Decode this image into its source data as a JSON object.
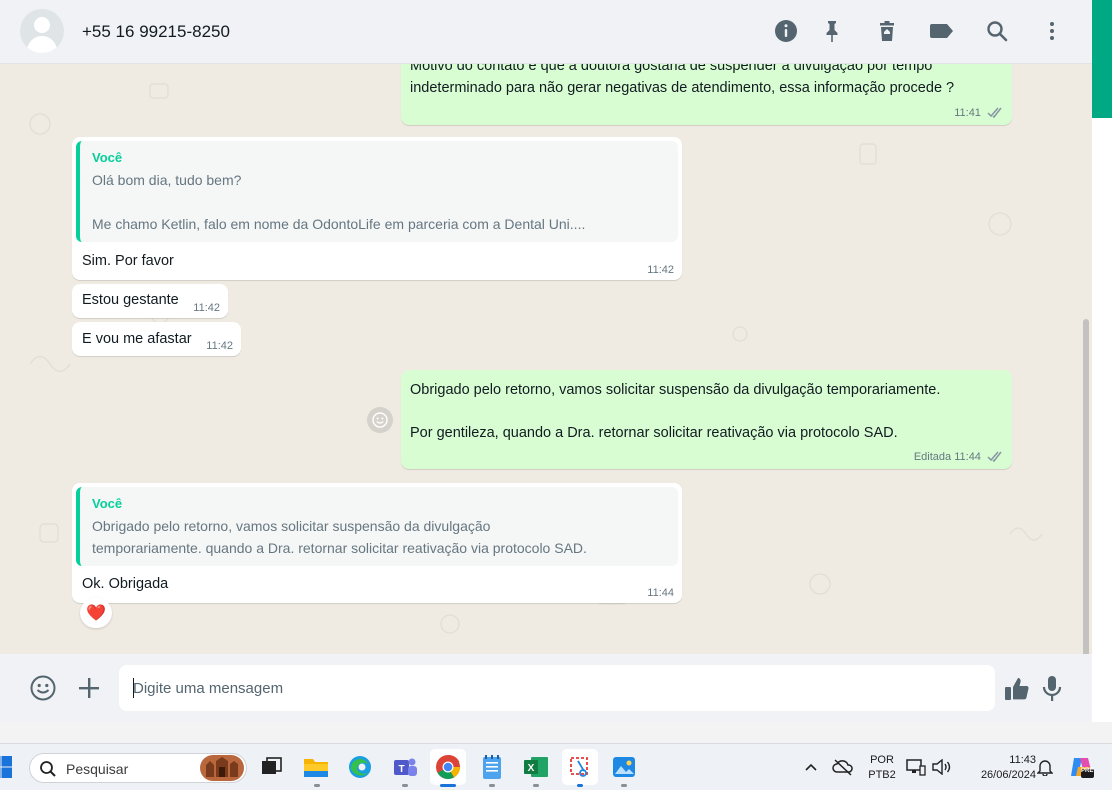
{
  "header": {
    "contact_name": "+55 16 99215-8250",
    "icons": [
      "info-icon",
      "pin-icon",
      "trash-icon",
      "label-icon",
      "search-icon",
      "more-vertical-icon"
    ]
  },
  "messages": {
    "m1": {
      "text_line1": "Motivo do contato é que a doutora gostaria de suspender a divulgação por tempo",
      "text_line2": "indeterminado para não gerar negativas de atendimento, essa informação procede ?",
      "time": "11:41"
    },
    "m2": {
      "quote_author": "Você",
      "quote_line1": "Olá bom dia, tudo bem?",
      "quote_line2": "Me chamo Ketlin, falo em nome da OdontoLife em parceria com a Dental Uni....",
      "text": "Sim. Por favor",
      "time": "11:42"
    },
    "m3": {
      "text": "Estou gestante",
      "time": "11:42"
    },
    "m4": {
      "text": "E vou me afastar",
      "time": "11:42"
    },
    "m5": {
      "text_line1": "Obrigado pelo retorno, vamos solicitar suspensão da divulgação temporariamente.",
      "text_line2": "Por gentileza, quando a Dra. retornar solicitar reativação via protocolo SAD.",
      "edited_label": "Editada",
      "time": "11:44"
    },
    "m6": {
      "quote_author": "Você",
      "quote_line1": "Obrigado pelo retorno, vamos solicitar suspensão da divulgação",
      "quote_line2": "temporariamente. quando a Dra. retornar solicitar reativação via protocolo SAD.",
      "text": "Ok. Obrigada",
      "time": "11:44",
      "reaction": "❤️"
    }
  },
  "composer": {
    "placeholder": "Digite uma mensagem"
  },
  "taskbar": {
    "search_placeholder": "Pesquisar",
    "lang_line1": "POR",
    "lang_line2": "PTB2",
    "clock_time": "11:43",
    "clock_date": "26/06/2024",
    "copilot_badge": "PRE"
  },
  "colors": {
    "accent": "#00a884",
    "outgoing_bubble": "#d9fdd3",
    "incoming_bubble": "#ffffff",
    "quote_bar": "#06cf9c",
    "chat_bg": "#efeae2",
    "ticks": "#8696a0"
  }
}
